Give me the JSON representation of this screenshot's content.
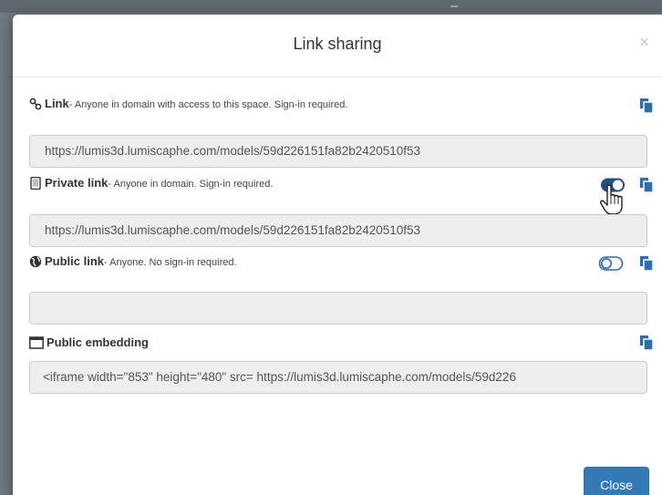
{
  "modal": {
    "title": "Link sharing",
    "close_x": "×",
    "close_button": "Close"
  },
  "sections": [
    {
      "icon": "link-icon",
      "title": "Link",
      "description": "- Anyone in domain with access to this space. Sign-in required.",
      "value": "https://lumis3d.lumiscaphe.com/models/59d226151fa82b2420510f53",
      "toggle": null
    },
    {
      "icon": "tablet-icon",
      "title": "Private link",
      "description": "- Anyone in domain. Sign-in required.",
      "value": "https://lumis3d.lumiscaphe.com/models/59d226151fa82b2420510f53",
      "toggle": "on"
    },
    {
      "icon": "globe-icon",
      "title": "Public link",
      "description": "- Anyone. No sign-in required.",
      "value": "",
      "toggle": "off"
    },
    {
      "icon": "window-icon",
      "title": "Public embedding",
      "description": "",
      "value": "<iframe width=\"853\" height=\"480\" src=  https://lumis3d.lumiscaphe.com/models/59d226",
      "toggle": null
    }
  ],
  "colors": {
    "accent": "#337ab7",
    "icon_blue": "#2a6db5",
    "field_bg": "#eeeeee"
  }
}
